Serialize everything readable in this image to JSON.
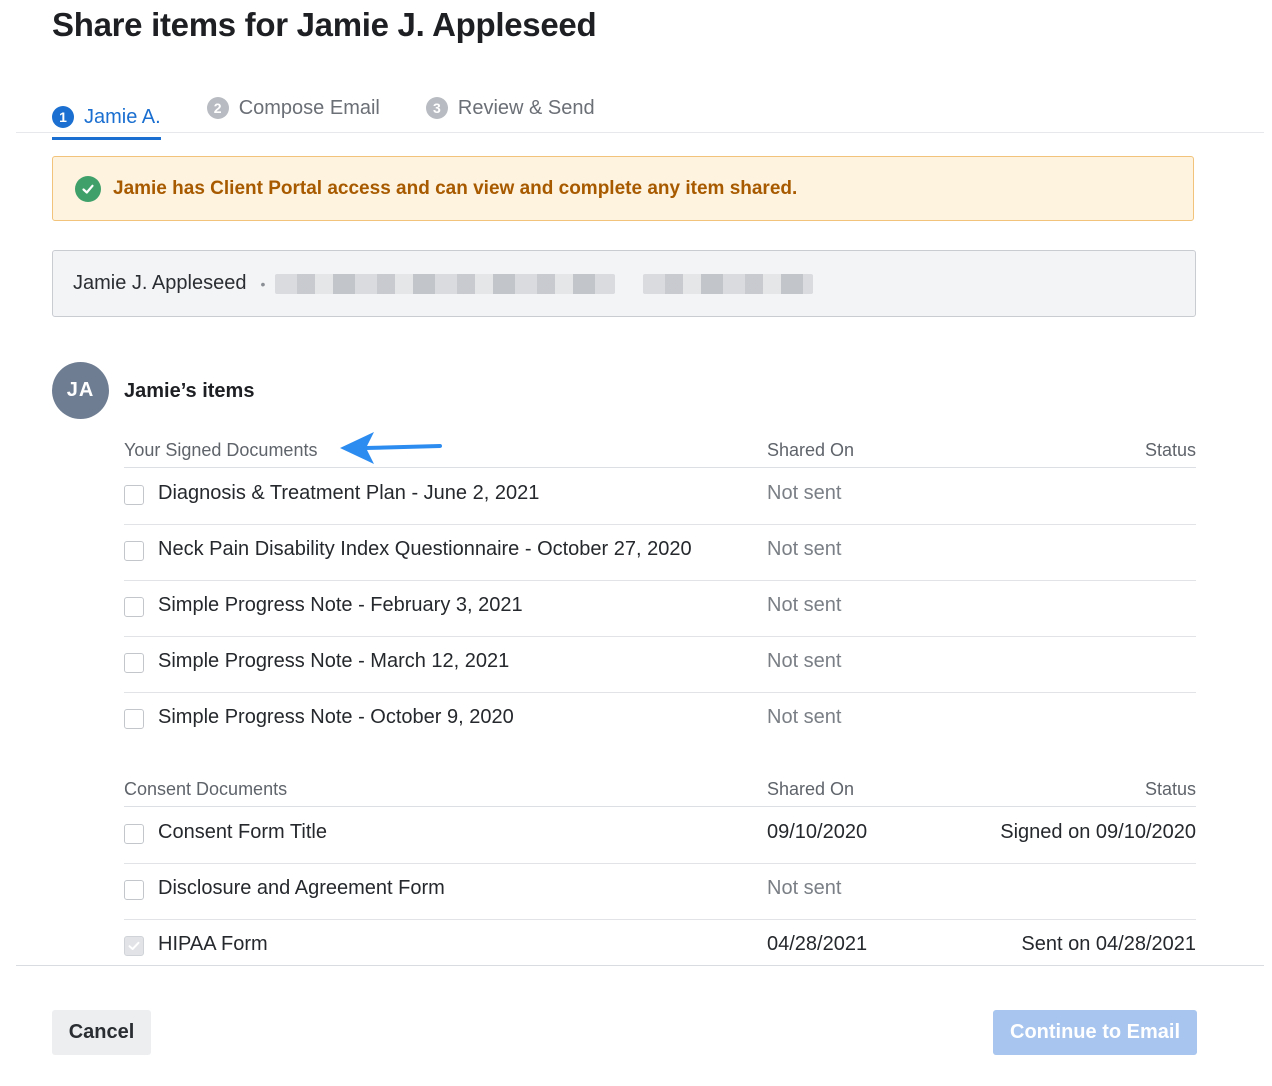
{
  "modal": {
    "title": "Share items for Jamie J. Appleseed"
  },
  "steps": [
    {
      "num": "1",
      "label": "Jamie A.",
      "active": true
    },
    {
      "num": "2",
      "label": "Compose Email",
      "active": false
    },
    {
      "num": "3",
      "label": "Review & Send",
      "active": false
    }
  ],
  "alert": {
    "message": "Jamie has Client Portal access and can view and complete any item shared."
  },
  "client": {
    "name": "Jamie J. Appleseed",
    "separator": "•"
  },
  "items": {
    "avatar_initials": "JA",
    "title": "Jamie’s items"
  },
  "signed_section": {
    "header": "Your Signed Documents",
    "shared_header": "Shared On",
    "status_header": "Status",
    "rows": [
      {
        "name": "Diagnosis & Treatment Plan - June 2, 2021",
        "shared": "Not sent",
        "status": ""
      },
      {
        "name": "Neck Pain Disability Index Questionnaire - October 27, 2020",
        "shared": "Not sent",
        "status": ""
      },
      {
        "name": "Simple Progress Note - February 3, 2021",
        "shared": "Not sent",
        "status": ""
      },
      {
        "name": "Simple Progress Note - March 12, 2021",
        "shared": "Not sent",
        "status": ""
      },
      {
        "name": "Simple Progress Note - October 9, 2020",
        "shared": "Not sent",
        "status": ""
      }
    ]
  },
  "consent_section": {
    "header": "Consent Documents",
    "shared_header": "Shared On",
    "status_header": "Status",
    "rows": [
      {
        "name": "Consent Form Title",
        "shared": "09/10/2020",
        "status": "Signed on 09/10/2020",
        "checked": false
      },
      {
        "name": "Disclosure and Agreement Form",
        "shared": "Not sent",
        "status": "",
        "checked": false
      },
      {
        "name": "HIPAA Form",
        "shared": "04/28/2021",
        "status": "Sent on 04/28/2021",
        "checked": true
      }
    ]
  },
  "footer": {
    "cancel_label": "Cancel",
    "continue_label": "Continue to Email"
  },
  "colors": {
    "accent": "#1a6fd0",
    "alert_bg": "#fdf3de",
    "alert_text": "#a85a00",
    "success": "#3fa06a",
    "continue_disabled": "#a7c5ee",
    "annotation_arrow": "#2d8cf0"
  },
  "icons": {
    "alert": "check-circle-icon",
    "annotation": "blue-arrow-icon"
  }
}
